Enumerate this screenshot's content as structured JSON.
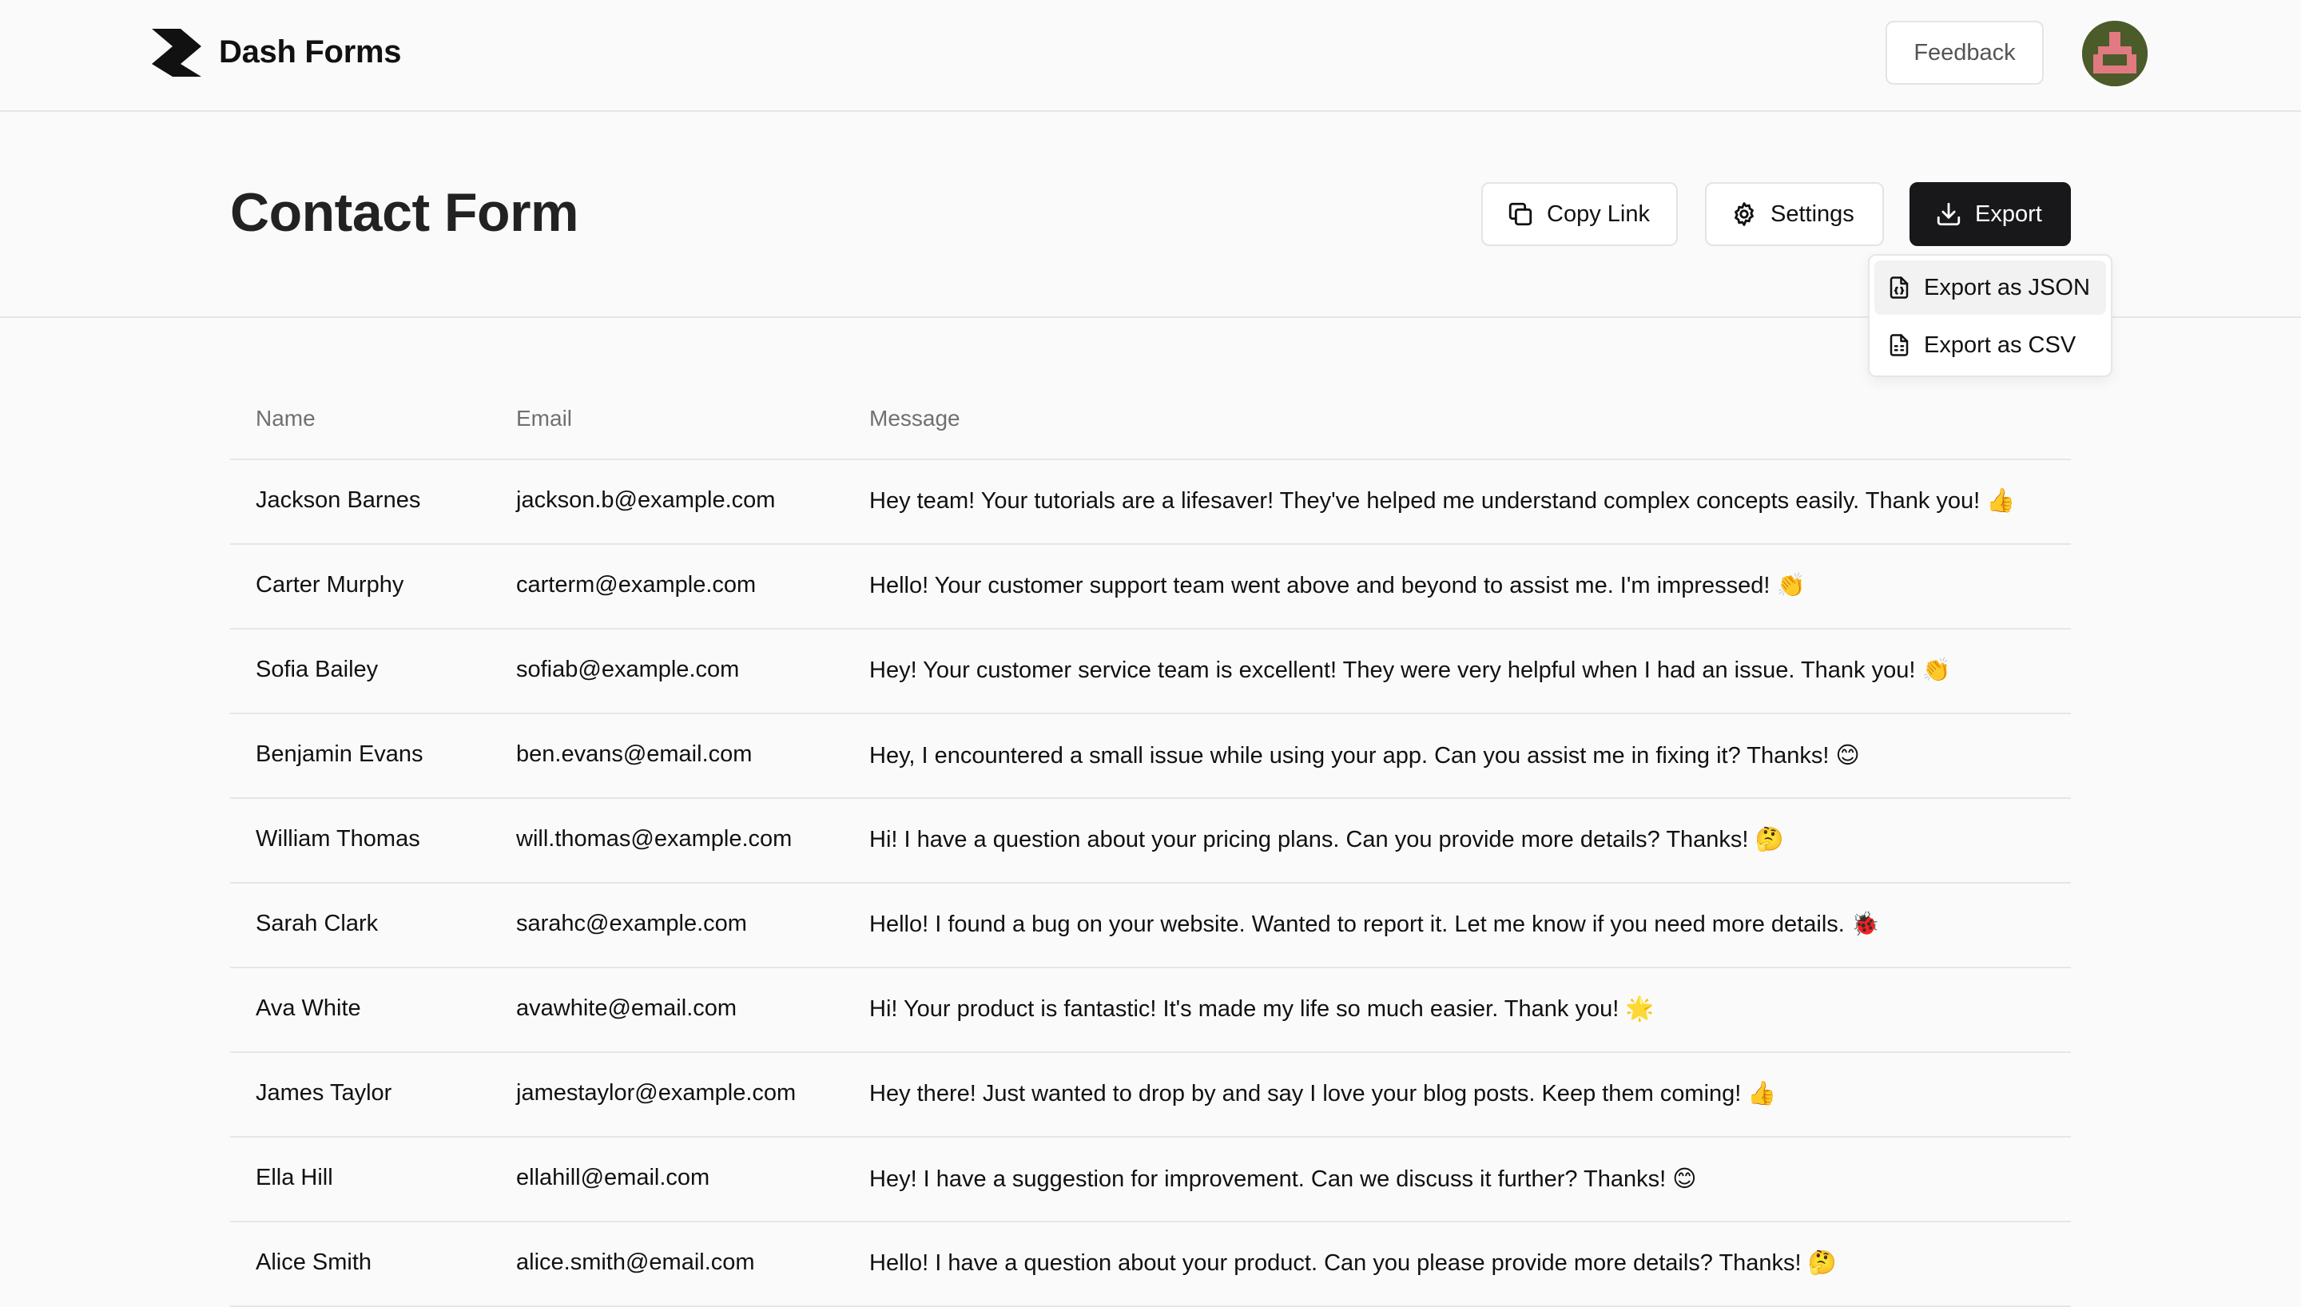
{
  "app": {
    "brand": "Dash Forms",
    "feedback_label": "Feedback"
  },
  "page": {
    "title": "Contact Form",
    "actions": {
      "copy_link": "Copy Link",
      "settings": "Settings",
      "export": "Export"
    },
    "export_menu": {
      "items": [
        {
          "label": "Export as JSON",
          "icon": "file-json-icon",
          "highlighted": true
        },
        {
          "label": "Export as CSV",
          "icon": "file-spreadsheet-icon",
          "highlighted": false
        }
      ]
    }
  },
  "table": {
    "columns": [
      "Name",
      "Email",
      "Message"
    ],
    "rows": [
      {
        "name": "Jackson Barnes",
        "email": "jackson.b@example.com",
        "message": "Hey team! Your tutorials are a lifesaver! They've helped me understand complex concepts easily. Thank you! 👍"
      },
      {
        "name": "Carter Murphy",
        "email": "carterm@example.com",
        "message": "Hello! Your customer support team went above and beyond to assist me. I'm impressed! 👏"
      },
      {
        "name": "Sofia Bailey",
        "email": "sofiab@example.com",
        "message": "Hey! Your customer service team is excellent! They were very helpful when I had an issue. Thank you! 👏"
      },
      {
        "name": "Benjamin Evans",
        "email": "ben.evans@email.com",
        "message": "Hey, I encountered a small issue while using your app. Can you assist me in fixing it? Thanks! 😊"
      },
      {
        "name": "William Thomas",
        "email": "will.thomas@example.com",
        "message": "Hi! I have a question about your pricing plans. Can you provide more details? Thanks! 🤔"
      },
      {
        "name": "Sarah Clark",
        "email": "sarahc@example.com",
        "message": "Hello! I found a bug on your website. Wanted to report it. Let me know if you need more details. 🐞"
      },
      {
        "name": "Ava White",
        "email": "avawhite@email.com",
        "message": "Hi! Your product is fantastic! It's made my life so much easier. Thank you! 🌟"
      },
      {
        "name": "James Taylor",
        "email": "jamestaylor@example.com",
        "message": "Hey there! Just wanted to drop by and say I love your blog posts. Keep them coming! 👍"
      },
      {
        "name": "Ella Hill",
        "email": "ellahill@email.com",
        "message": "Hey! I have a suggestion for improvement. Can we discuss it further? Thanks! 😊"
      },
      {
        "name": "Alice Smith",
        "email": "alice.smith@email.com",
        "message": "Hello! I have a question about your product. Can you please provide more details? Thanks! 🤔"
      }
    ]
  },
  "colors": {
    "background": "#fafafa",
    "primary_button": "#18181b",
    "border": "#e6e6e6",
    "muted_text": "#707070"
  }
}
